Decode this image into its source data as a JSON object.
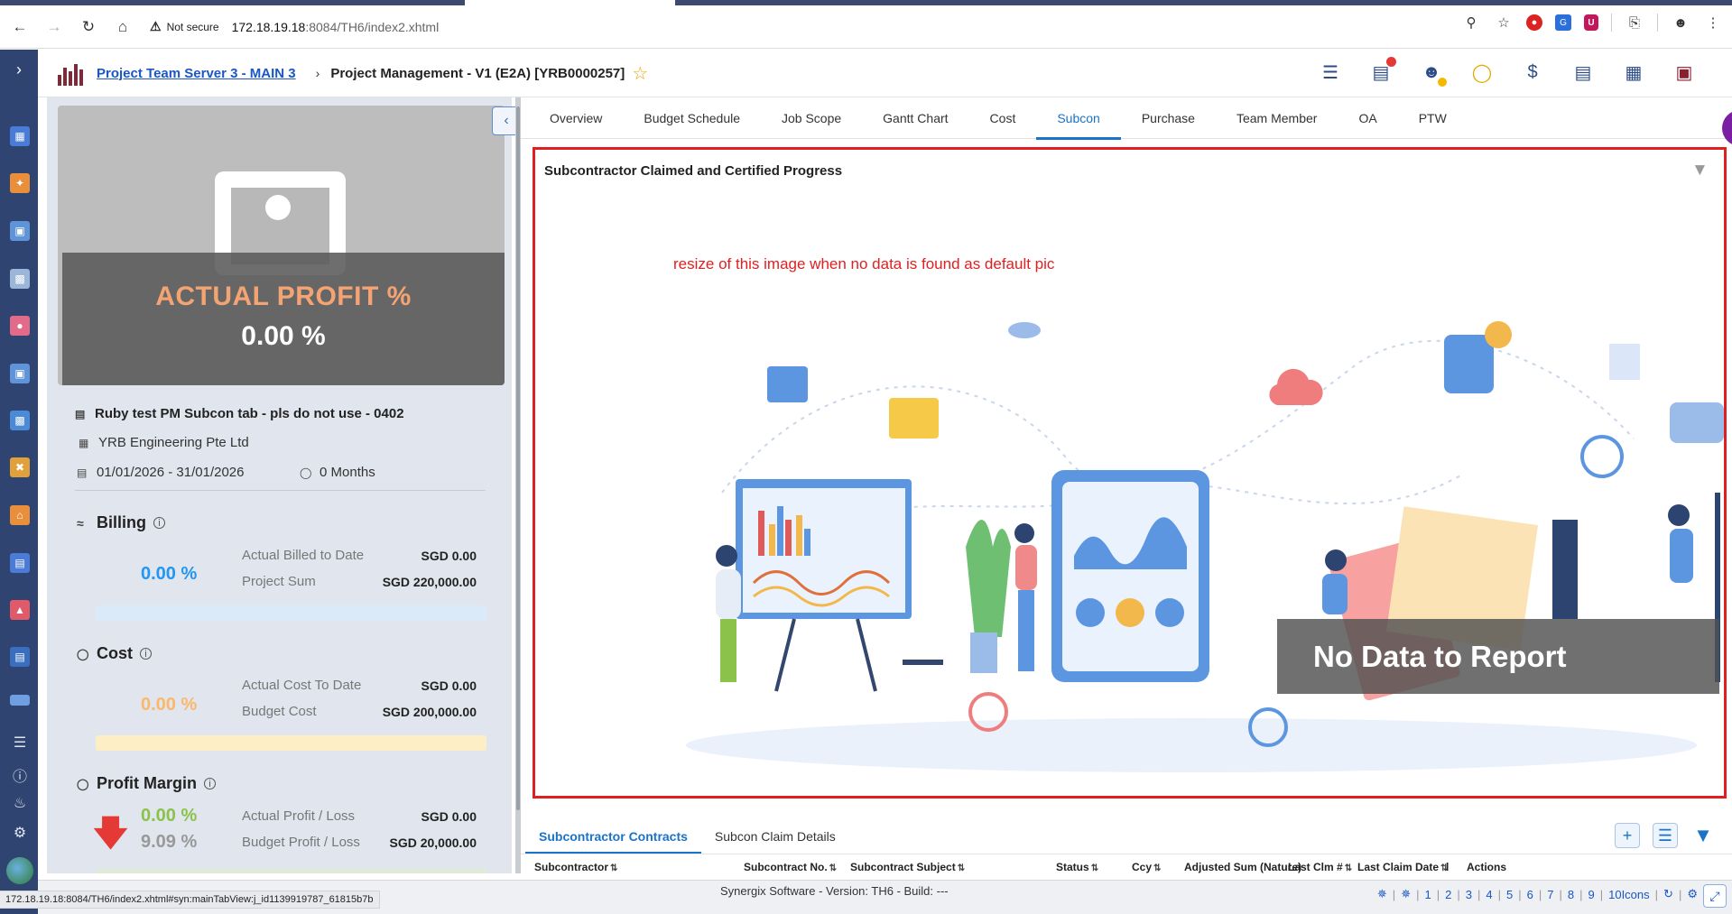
{
  "browser": {
    "not_secure": "Not secure",
    "url_host": "172.18.19.18",
    "url_path": ":8084/TH6/index2.xhtml",
    "status_url": "172.18.19.18:8084/TH6/index2.xhtml#syn:mainTabView:j_id1139919787_61815b7b"
  },
  "header": {
    "breadcrumb_link": "Project Team Server 3 - MAIN 3",
    "title": "Project Management - V1 (E2A) [YRB0000257]"
  },
  "summary": {
    "hero_label": "ACTUAL PROFIT %",
    "hero_value": "0.00 %",
    "project_name": "Ruby test PM Subcon tab - pls do not use - 0402",
    "company": "YRB Engineering Pte Ltd",
    "date_range": "01/01/2026 - 31/01/2026",
    "duration": "0 Months",
    "billing": {
      "title": "Billing",
      "pct": "0.00 %",
      "actual_label": "Actual Billed to Date",
      "actual_value": "SGD 0.00",
      "sum_label": "Project Sum",
      "sum_value": "SGD 220,000.00",
      "progress": 0,
      "color": "#2196f3"
    },
    "cost": {
      "title": "Cost",
      "pct": "0.00 %",
      "actual_label": "Actual Cost To Date",
      "actual_value": "SGD 0.00",
      "budget_label": "Budget Cost",
      "budget_value": "SGD 200,000.00",
      "progress": 0,
      "color": "#f9a825"
    },
    "profit": {
      "title": "Profit Margin",
      "actual_pct": "0.00 %",
      "budget_pct": "9.09 %",
      "actual_label": "Actual Profit / Loss",
      "actual_value": "SGD 0.00",
      "budget_label": "Budget Profit / Loss",
      "budget_value": "SGD 20,000.00",
      "color": "#4caf50"
    }
  },
  "tabs": [
    {
      "label": "Overview"
    },
    {
      "label": "Budget Schedule"
    },
    {
      "label": "Job Scope"
    },
    {
      "label": "Gantt Chart"
    },
    {
      "label": "Cost"
    },
    {
      "label": "Subcon",
      "active": true
    },
    {
      "label": "Purchase"
    },
    {
      "label": "Team Member"
    },
    {
      "label": "OA"
    },
    {
      "label": "PTW"
    }
  ],
  "panel": {
    "title": "Subcontractor Claimed and Certified Progress",
    "note": "resize of this image when no data is found as default pic",
    "no_data": "No Data to Report"
  },
  "grid": {
    "subtabs": [
      {
        "label": "Subcontractor Contracts",
        "active": true
      },
      {
        "label": "Subcon Claim Details"
      }
    ],
    "columns": [
      "Subcontractor",
      "Subcontract No.",
      "Subcontract Subject",
      "Status",
      "Ccy",
      "Adjusted Sum (Nature)",
      "Last Clm #",
      "Last Claim Date",
      "l",
      "Actions"
    ]
  },
  "footer": {
    "version": "Synergix Software - Version: TH6 - Build: ---",
    "pages": [
      "1",
      "2",
      "3",
      "4",
      "5",
      "6",
      "7",
      "8",
      "9"
    ],
    "icons_label": "10Icons"
  },
  "colors": {
    "rail": "#2f4470",
    "accent": "#1a73c8",
    "highlight_border": "#e02020"
  }
}
